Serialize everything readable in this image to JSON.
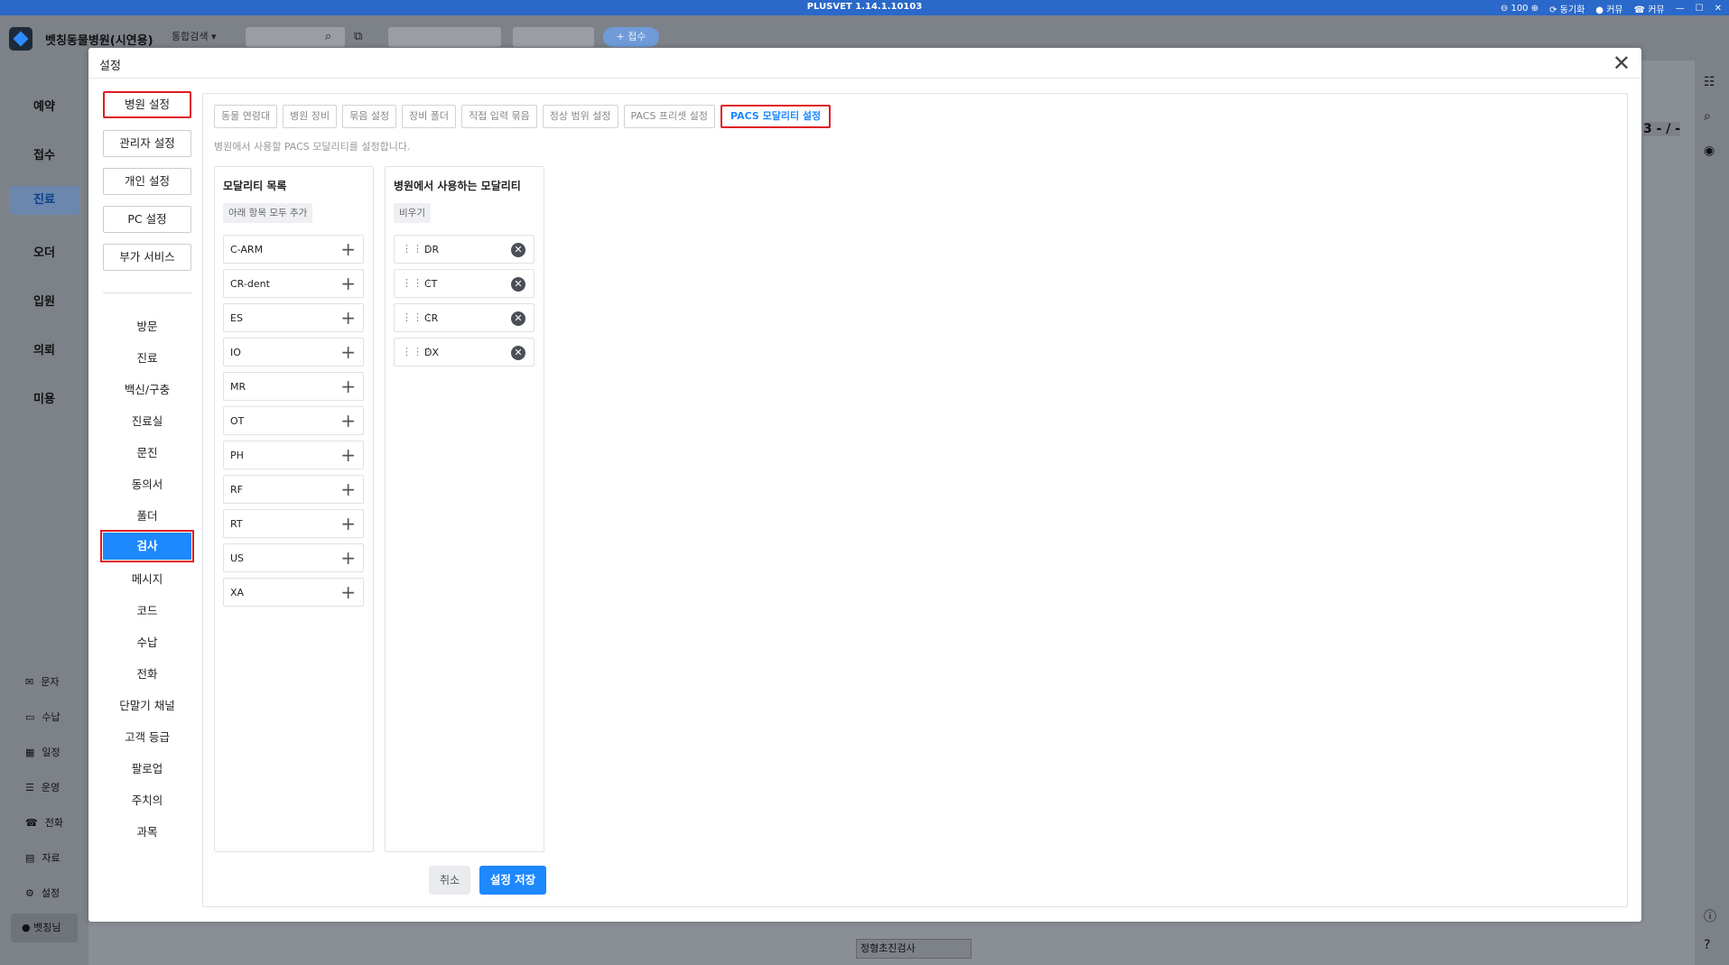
{
  "titlebar": {
    "version": "PLUSVET 1.14.1.10103",
    "zoom": "100",
    "sync": "동기화",
    "community": "커뮤",
    "contact": "커뮤"
  },
  "appbar": {
    "hospital": "벳칭동물병원(시연용)",
    "search_mode": "통합검색 ▾",
    "register": "+ 접수"
  },
  "leftnav": {
    "main": [
      "예약",
      "접수",
      "진료",
      "오더",
      "입원",
      "의뢰",
      "미용"
    ],
    "sub": [
      "문자",
      "수납",
      "일정",
      "운영",
      "전화",
      "자료",
      "설정"
    ],
    "user": "벳칭님"
  },
  "modal": {
    "title": "설정",
    "close": "✕",
    "categories": [
      "병원 설정",
      "관리자 설정",
      "개인 설정",
      "PC 설정",
      "부가 서비스"
    ],
    "menu": [
      "방문",
      "진료",
      "백신/구충",
      "진료실",
      "문진",
      "동의서",
      "폴더",
      "검사",
      "메시지",
      "코드",
      "수납",
      "전화",
      "단말기 채널",
      "고객 등급",
      "팔로업",
      "주치의",
      "과목"
    ],
    "tabs": [
      "동물 연령대",
      "병원 장비",
      "묶음 설정",
      "장비 폴더",
      "직접 입력 묶음",
      "정상 범위 설정",
      "PACS 프리셋 설정",
      "PACS 모달리티 설정"
    ],
    "description": "병원에서 사용할 PACS 모달리티를 설정합니다.",
    "available": {
      "title": "모달리티 목록",
      "action": "아래 항목 모두 추가",
      "items": [
        "C-ARM",
        "CR-dent",
        "ES",
        "IO",
        "MR",
        "OT",
        "PH",
        "RF",
        "RT",
        "US",
        "XA"
      ]
    },
    "used": {
      "title": "병원에서 사용하는 모달리티",
      "action": "비우기",
      "items": [
        "DR",
        "CT",
        "CR",
        "DX"
      ]
    },
    "cancel": "취소",
    "save": "설정 저장"
  },
  "background": {
    "frag1": "정형초진검사",
    "frag2": "3 - / -"
  },
  "colors": {
    "accent": "#1e88ff",
    "highlight": "#e01b24",
    "titlebar": "#2a68c9"
  }
}
